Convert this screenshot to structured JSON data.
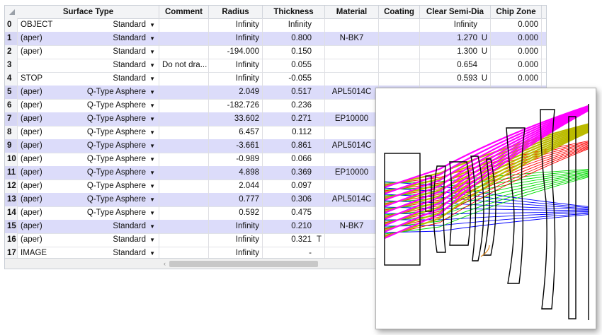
{
  "columns": [
    {
      "key": "num",
      "label": ""
    },
    {
      "key": "type",
      "label": "Surface Type"
    },
    {
      "key": "comment",
      "label": "Comment"
    },
    {
      "key": "radius",
      "label": "Radius"
    },
    {
      "key": "thickness",
      "label": "Thickness"
    },
    {
      "key": "material",
      "label": "Material"
    },
    {
      "key": "coating",
      "label": "Coating"
    },
    {
      "key": "semidia",
      "label": "Clear Semi-Dia"
    },
    {
      "key": "chip",
      "label": "Chip Zone"
    }
  ],
  "rows": [
    {
      "num": "0",
      "name": "OBJECT",
      "type": "Standard",
      "comment": "",
      "radius": "Infinity",
      "thickness": "Infinity",
      "tflag": "",
      "material": "",
      "coating": "",
      "semidia": "Infinity",
      "sflag": "",
      "chip": "0.000",
      "highlight": false
    },
    {
      "num": "1",
      "name": "(aper)",
      "type": "Standard",
      "comment": "",
      "radius": "Infinity",
      "thickness": "0.800",
      "tflag": "",
      "material": "N-BK7",
      "coating": "",
      "semidia": "1.270",
      "sflag": "U",
      "chip": "0.000",
      "highlight": true
    },
    {
      "num": "2",
      "name": "(aper)",
      "type": "Standard",
      "comment": "",
      "radius": "-194.000",
      "thickness": "0.150",
      "tflag": "",
      "material": "",
      "coating": "",
      "semidia": "1.300",
      "sflag": "U",
      "chip": "0.000",
      "highlight": false
    },
    {
      "num": "3",
      "name": "",
      "type": "Standard",
      "comment": "Do not dra...",
      "radius": "Infinity",
      "thickness": "0.055",
      "tflag": "",
      "material": "",
      "coating": "",
      "semidia": "0.654",
      "sflag": "",
      "chip": "0.000",
      "highlight": false
    },
    {
      "num": "4",
      "name": "STOP",
      "type": "Standard",
      "comment": "",
      "radius": "Infinity",
      "thickness": "-0.055",
      "tflag": "",
      "material": "",
      "coating": "",
      "semidia": "0.593",
      "sflag": "U",
      "chip": "0.000",
      "highlight": false
    },
    {
      "num": "5",
      "name": "(aper)",
      "type": "Q-Type Asphere",
      "comment": "",
      "radius": "2.049",
      "thickness": "0.517",
      "tflag": "",
      "material": "APL5014C",
      "coating": "",
      "semidia": "",
      "sflag": "",
      "chip": "",
      "highlight": true
    },
    {
      "num": "6",
      "name": "(aper)",
      "type": "Q-Type Asphere",
      "comment": "",
      "radius": "-182.726",
      "thickness": "0.236",
      "tflag": "",
      "material": "",
      "coating": "",
      "semidia": "",
      "sflag": "",
      "chip": "",
      "highlight": false
    },
    {
      "num": "7",
      "name": "(aper)",
      "type": "Q-Type Asphere",
      "comment": "",
      "radius": "33.602",
      "thickness": "0.271",
      "tflag": "",
      "material": "EP10000",
      "coating": "",
      "semidia": "",
      "sflag": "",
      "chip": "",
      "highlight": true
    },
    {
      "num": "8",
      "name": "(aper)",
      "type": "Q-Type Asphere",
      "comment": "",
      "radius": "6.457",
      "thickness": "0.112",
      "tflag": "",
      "material": "",
      "coating": "",
      "semidia": "",
      "sflag": "",
      "chip": "",
      "highlight": false
    },
    {
      "num": "9",
      "name": "(aper)",
      "type": "Q-Type Asphere",
      "comment": "",
      "radius": "-3.661",
      "thickness": "0.861",
      "tflag": "",
      "material": "APL5014C",
      "coating": "",
      "semidia": "",
      "sflag": "",
      "chip": "",
      "highlight": true
    },
    {
      "num": "10",
      "name": "(aper)",
      "type": "Q-Type Asphere",
      "comment": "",
      "radius": "-0.989",
      "thickness": "0.066",
      "tflag": "",
      "material": "",
      "coating": "",
      "semidia": "",
      "sflag": "",
      "chip": "",
      "highlight": false
    },
    {
      "num": "11",
      "name": "(aper)",
      "type": "Q-Type Asphere",
      "comment": "",
      "radius": "4.898",
      "thickness": "0.369",
      "tflag": "",
      "material": "EP10000",
      "coating": "",
      "semidia": "",
      "sflag": "",
      "chip": "",
      "highlight": true
    },
    {
      "num": "12",
      "name": "(aper)",
      "type": "Q-Type Asphere",
      "comment": "",
      "radius": "2.044",
      "thickness": "0.097",
      "tflag": "",
      "material": "",
      "coating": "",
      "semidia": "",
      "sflag": "",
      "chip": "",
      "highlight": false
    },
    {
      "num": "13",
      "name": "(aper)",
      "type": "Q-Type Asphere",
      "comment": "",
      "radius": "0.777",
      "thickness": "0.306",
      "tflag": "",
      "material": "APL5014C",
      "coating": "",
      "semidia": "",
      "sflag": "",
      "chip": "",
      "highlight": true
    },
    {
      "num": "14",
      "name": "(aper)",
      "type": "Q-Type Asphere",
      "comment": "",
      "radius": "0.592",
      "thickness": "0.475",
      "tflag": "",
      "material": "",
      "coating": "",
      "semidia": "",
      "sflag": "",
      "chip": "",
      "highlight": false
    },
    {
      "num": "15",
      "name": "(aper)",
      "type": "Standard",
      "comment": "",
      "radius": "Infinity",
      "thickness": "0.210",
      "tflag": "",
      "material": "N-BK7",
      "coating": "",
      "semidia": "",
      "sflag": "",
      "chip": "",
      "highlight": true
    },
    {
      "num": "16",
      "name": "(aper)",
      "type": "Standard",
      "comment": "",
      "radius": "Infinity",
      "thickness": "0.321",
      "tflag": "T",
      "material": "",
      "coating": "",
      "semidia": "",
      "sflag": "",
      "chip": "",
      "highlight": false
    },
    {
      "num": "17",
      "name": "IMAGE",
      "type": "Standard",
      "comment": "",
      "radius": "Infinity",
      "thickness": "-",
      "tflag": "",
      "material": "",
      "coating": "",
      "semidia": "",
      "sflag": "",
      "chip": "",
      "highlight": false
    }
  ],
  "icons": {
    "dropdown": "dropdown-arrow-icon",
    "scroll_left": "scroll-left-arrow-icon"
  },
  "colors": {
    "row_highlight": "#dcdcfa",
    "header_bg": "#f3f4f6",
    "ray_fields": [
      "#0000ff",
      "#00dd00",
      "#ff0000",
      "#bbbb00",
      "#ff00ff"
    ]
  }
}
